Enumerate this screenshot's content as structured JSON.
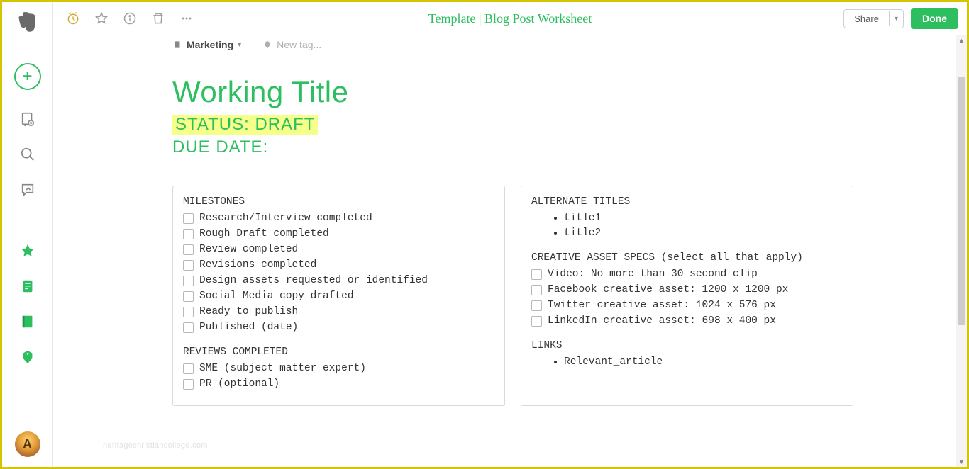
{
  "header": {
    "title": "Template | Blog Post Worksheet",
    "share_label": "Share",
    "done_label": "Done"
  },
  "meta": {
    "notebook": "Marketing",
    "tag_placeholder": "New tag..."
  },
  "note": {
    "working_title": "Working Title",
    "status_line": "STATUS: DRAFT",
    "due_date_line": "DUE DATE:"
  },
  "card_left": {
    "milestones_heading": "MILESTONES",
    "milestones": [
      "Research/Interview completed",
      "Rough Draft completed",
      "Review completed",
      "Revisions completed",
      "Design assets requested or identified",
      "Social Media copy drafted",
      "Ready to publish",
      "Published (date)"
    ],
    "reviews_heading": "REVIEWS COMPLETED",
    "reviews": [
      "SME (subject matter expert)",
      "PR (optional)"
    ]
  },
  "card_right": {
    "alt_heading": "ALTERNATE TITLES",
    "alt_titles": [
      "title1",
      "title2"
    ],
    "specs_heading": "CREATIVE ASSET SPECS (select all that apply)",
    "specs": [
      "Video: No more than 30 second clip",
      "Facebook creative asset: 1200 x 1200 px",
      "Twitter creative asset: 1024 x 576 px",
      "LinkedIn creative asset: 698 x 400 px"
    ],
    "links_heading": "LINKS",
    "links": [
      "Relevant_article"
    ]
  },
  "watermark": "heritagechristiancollege.com",
  "avatar_initial": "A"
}
